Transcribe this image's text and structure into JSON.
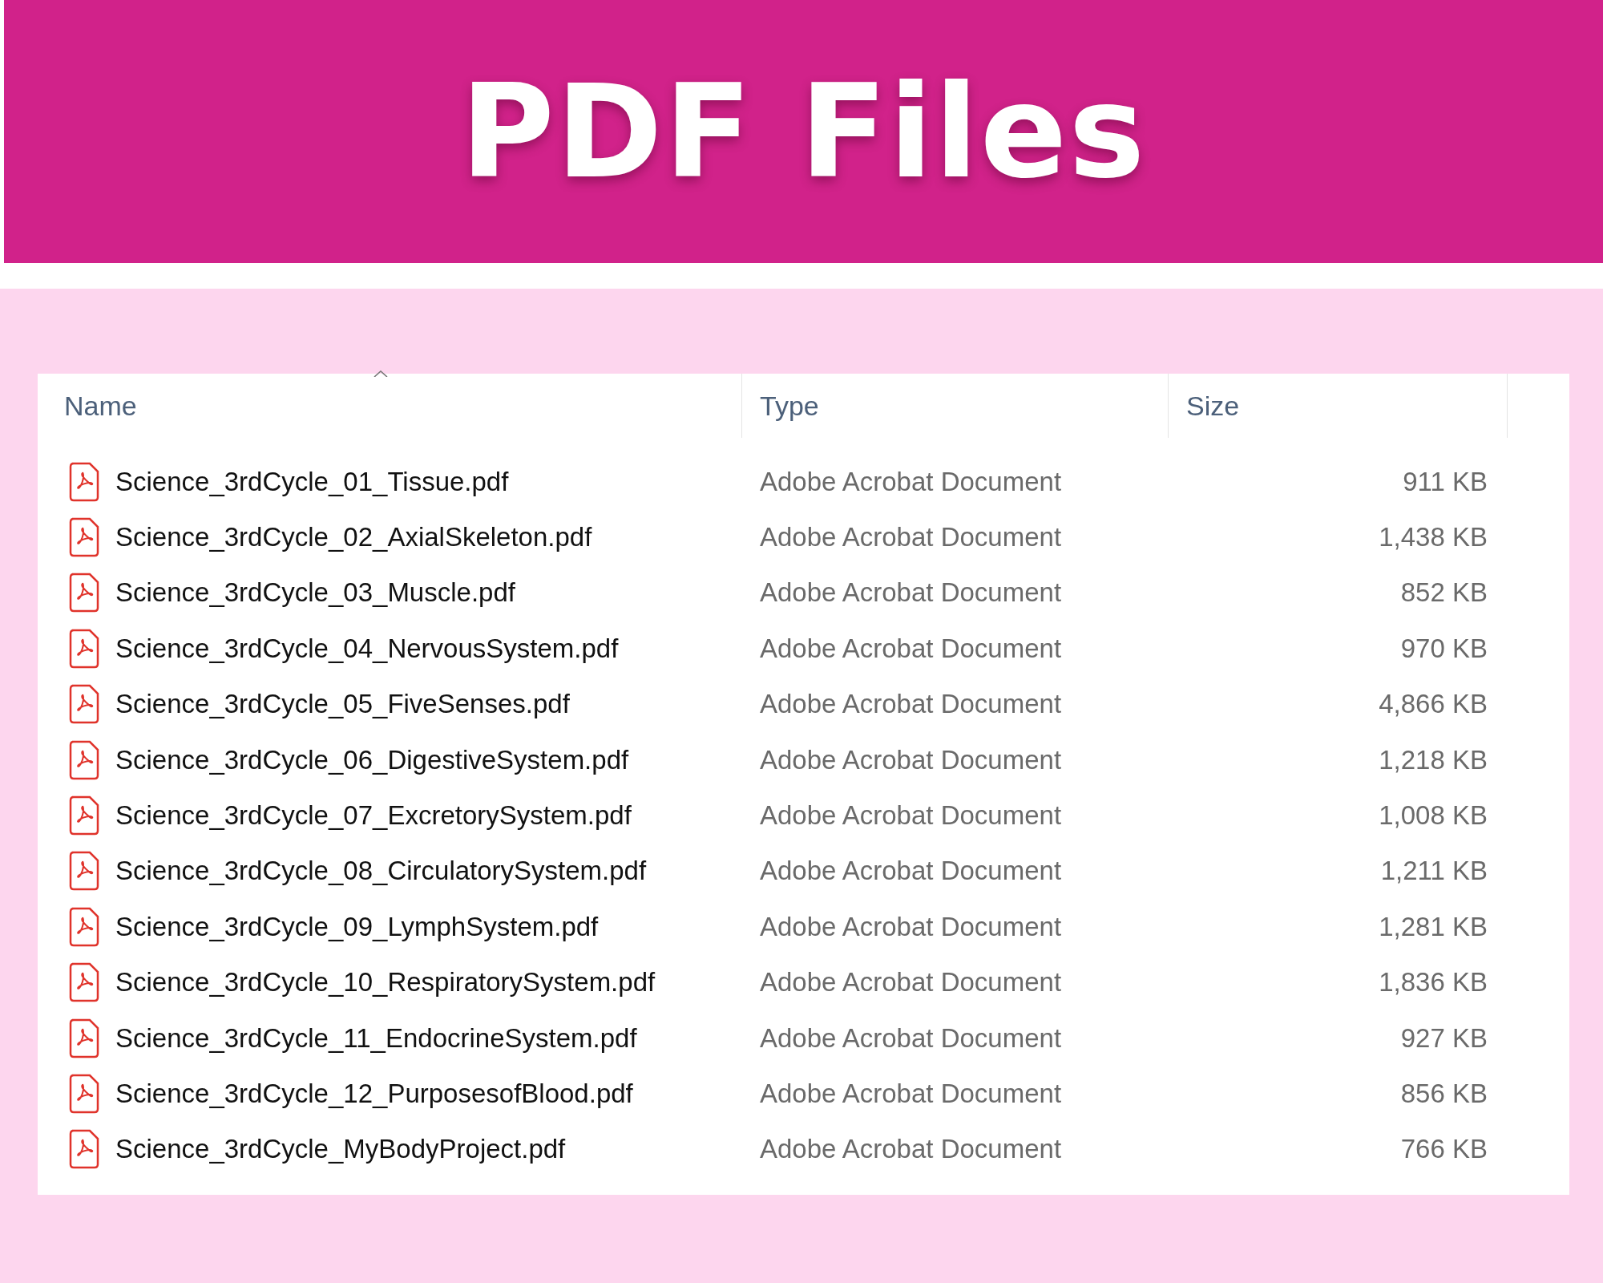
{
  "banner": {
    "title": "PDF Files"
  },
  "columns": [
    {
      "label": "Name",
      "sorted": true
    },
    {
      "label": "Type",
      "sorted": false
    },
    {
      "label": "Size",
      "sorted": false
    }
  ],
  "files": [
    {
      "name": "Science_3rdCycle_01_Tissue.pdf",
      "type": "Adobe Acrobat Document",
      "size": "911 KB"
    },
    {
      "name": "Science_3rdCycle_02_AxialSkeleton.pdf",
      "type": "Adobe Acrobat Document",
      "size": "1,438 KB"
    },
    {
      "name": "Science_3rdCycle_03_Muscle.pdf",
      "type": "Adobe Acrobat Document",
      "size": "852 KB"
    },
    {
      "name": "Science_3rdCycle_04_NervousSystem.pdf",
      "type": "Adobe Acrobat Document",
      "size": "970 KB"
    },
    {
      "name": "Science_3rdCycle_05_FiveSenses.pdf",
      "type": "Adobe Acrobat Document",
      "size": "4,866 KB"
    },
    {
      "name": "Science_3rdCycle_06_DigestiveSystem.pdf",
      "type": "Adobe Acrobat Document",
      "size": "1,218 KB"
    },
    {
      "name": "Science_3rdCycle_07_ExcretorySystem.pdf",
      "type": "Adobe Acrobat Document",
      "size": "1,008 KB"
    },
    {
      "name": "Science_3rdCycle_08_CirculatorySystem.pdf",
      "type": "Adobe Acrobat Document",
      "size": "1,211 KB"
    },
    {
      "name": "Science_3rdCycle_09_LymphSystem.pdf",
      "type": "Adobe Acrobat Document",
      "size": "1,281 KB"
    },
    {
      "name": "Science_3rdCycle_10_RespiratorySystem.pdf",
      "type": "Adobe Acrobat Document",
      "size": "1,836 KB"
    },
    {
      "name": "Science_3rdCycle_11_EndocrineSystem.pdf",
      "type": "Adobe Acrobat Document",
      "size": "927 KB"
    },
    {
      "name": "Science_3rdCycle_12_PurposesofBlood.pdf",
      "type": "Adobe Acrobat Document",
      "size": "856 KB"
    },
    {
      "name": "Science_3rdCycle_MyBodyProject.pdf",
      "type": "Adobe Acrobat Document",
      "size": "766 KB"
    }
  ]
}
